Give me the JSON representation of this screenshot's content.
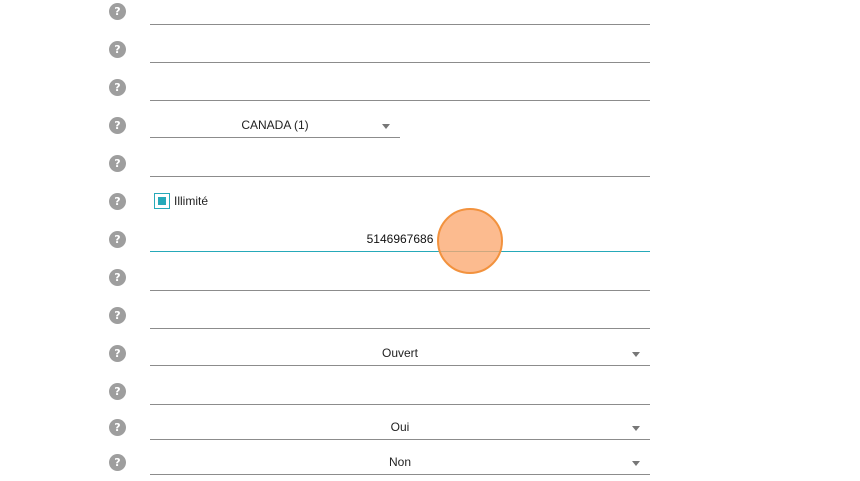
{
  "form": {
    "country_select": {
      "value": "CANADA (1)"
    },
    "unlimited_checkbox": {
      "label": "Illimité",
      "checked": true
    },
    "phone_input": {
      "value": "5146967686"
    },
    "status_select": {
      "value": "Ouvert"
    },
    "yes_no_select_1": {
      "value": "Oui"
    },
    "yes_no_select_2": {
      "value": "Non"
    }
  },
  "icons": {
    "help": "help-question-icon",
    "dropdown": "chevron-down-icon",
    "touch": "touch-indicator"
  },
  "colors": {
    "accent": "#26a9b9",
    "icon_gray": "#9e9e9e",
    "underline": "#8c8c8c",
    "touch_fill": "#fba870",
    "touch_border": "#f2923e"
  }
}
